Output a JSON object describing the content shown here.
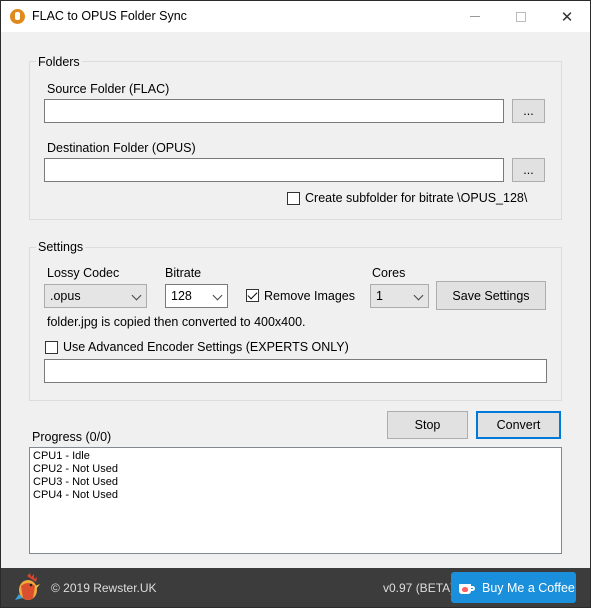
{
  "window": {
    "title": "FLAC to OPUS Folder Sync",
    "close_glyph": "✕"
  },
  "folders": {
    "group_label": "Folders",
    "source_label": "Source Folder (FLAC)",
    "source_value": "",
    "source_browse": "...",
    "dest_label": "Destination Folder (OPUS)",
    "dest_value": "",
    "dest_browse": "...",
    "subfolder_checkbox_label": "Create subfolder for bitrate \\OPUS_128\\",
    "subfolder_checked": false
  },
  "settings": {
    "group_label": "Settings",
    "codec_label": "Lossy Codec",
    "codec_value": ".opus",
    "bitrate_label": "Bitrate",
    "bitrate_value": "128",
    "remove_images_label": "Remove Images",
    "remove_images_checked": true,
    "cores_label": "Cores",
    "cores_value": "1",
    "save_button": "Save Settings",
    "info_text": "folder.jpg is copied then converted to 400x400.",
    "advanced_label": "Use Advanced Encoder Settings (EXPERTS ONLY)",
    "advanced_checked": false,
    "advanced_value": ""
  },
  "actions": {
    "stop_button": "Stop",
    "convert_button": "Convert"
  },
  "progress": {
    "label": "Progress (0/0)",
    "lines": [
      "CPU1 - Idle",
      "CPU2 - Not Used",
      "CPU3 - Not Used",
      "CPU4 - Not Used"
    ]
  },
  "footer": {
    "copyright": "© 2019 Rewster.UK",
    "version": "v0.97 (BETA)",
    "coffee_button": "Buy Me a Coffee"
  },
  "colors": {
    "accent": "#0078d7",
    "coffee": "#1a8fdc",
    "footer_bg": "#3c3c3c"
  }
}
